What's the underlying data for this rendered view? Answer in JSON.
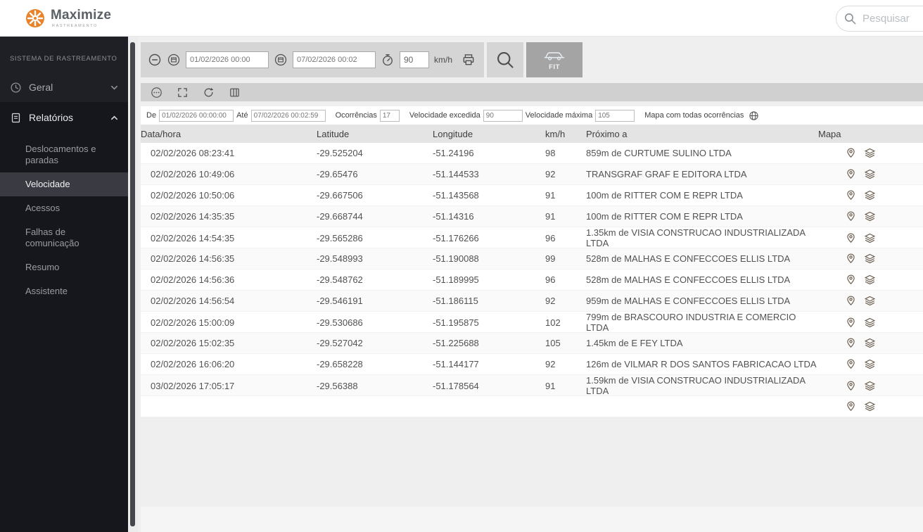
{
  "header": {
    "logo_text": "Maximize",
    "logo_sub": "RASTREAMENTO",
    "search_placeholder": "Pesquisar"
  },
  "sidebar": {
    "system_label": "SISTEMA DE RASTREAMENTO",
    "sections": [
      {
        "label": "Geral"
      },
      {
        "label": "Relatórios"
      }
    ],
    "report_items": [
      {
        "label": "Deslocamentos e paradas",
        "selected": false
      },
      {
        "label": "Velocidade",
        "selected": true
      },
      {
        "label": "Acessos",
        "selected": false
      },
      {
        "label": "Falhas de comunicação",
        "selected": false
      },
      {
        "label": "Resumo",
        "selected": false
      },
      {
        "label": "Assistente",
        "selected": false
      }
    ]
  },
  "toolbar": {
    "date_from": "01/02/2026 00:00",
    "date_to": "07/02/2026 00:02",
    "speed": "90",
    "speed_unit": "km/h",
    "vehicle_label": "FIT"
  },
  "filters": {
    "de_label": "De",
    "de_value": "01/02/2026 00:00:00",
    "ate_label": "Até",
    "ate_value": "07/02/2026 00:02:59",
    "ocorrencias_label": "Ocorrências",
    "ocorrencias_value": "17",
    "vel_excedida_label": "Velocidade excedida",
    "vel_excedida_value": "90",
    "vel_maxima_label": "Velocidade máxima",
    "vel_maxima_value": "105",
    "mapa_label": "Mapa com todas ocorrências"
  },
  "table": {
    "headers": [
      "Data/hora",
      "Latitude",
      "Longitude",
      "km/h",
      "Próximo a",
      "Mapa"
    ],
    "rows": [
      [
        "02/02/2026 08:23:41",
        "-29.525204",
        "-51.24196",
        "98",
        "859m de CURTUME SULINO LTDA"
      ],
      [
        "02/02/2026 10:49:06",
        "-29.65476",
        "-51.144533",
        "92",
        "TRANSGRAF GRAF E EDITORA LTDA"
      ],
      [
        "02/02/2026 10:50:06",
        "-29.667506",
        "-51.143568",
        "91",
        "100m de RITTER COM E REPR LTDA"
      ],
      [
        "02/02/2026 14:35:35",
        "-29.668744",
        "-51.14316",
        "91",
        "100m de RITTER COM E REPR LTDA"
      ],
      [
        "02/02/2026 14:54:35",
        "-29.565286",
        "-51.176266",
        "96",
        "1.35km de VISIA CONSTRUCAO INDUSTRIALIZADA LTDA"
      ],
      [
        "02/02/2026 14:56:35",
        "-29.548993",
        "-51.190088",
        "99",
        "528m de MALHAS E CONFECCOES ELLIS LTDA"
      ],
      [
        "02/02/2026 14:56:36",
        "-29.548762",
        "-51.189995",
        "96",
        "528m de MALHAS E CONFECCOES ELLIS LTDA"
      ],
      [
        "02/02/2026 14:56:54",
        "-29.546191",
        "-51.186115",
        "92",
        "959m de MALHAS E CONFECCOES ELLIS LTDA"
      ],
      [
        "02/02/2026 15:00:09",
        "-29.530686",
        "-51.195875",
        "102",
        "799m de BRASCOURO INDUSTRIA E COMERCIO LTDA"
      ],
      [
        "02/02/2026 15:02:35",
        "-29.527042",
        "-51.225688",
        "105",
        "1.45km de E FEY LTDA"
      ],
      [
        "02/02/2026 16:06:20",
        "-29.658228",
        "-51.144177",
        "92",
        "126m de VILMAR R DOS SANTOS FABRICACAO LTDA"
      ],
      [
        "03/02/2026 17:05:17",
        "-29.56388",
        "-51.178564",
        "91",
        "1.59km de VISIA CONSTRUCAO INDUSTRIALIZADA LTDA"
      ]
    ]
  },
  "colors": {
    "brand_orange": "#e8832a",
    "sidebar_dark": "#16171c",
    "selected_item": "#3a3b42"
  }
}
